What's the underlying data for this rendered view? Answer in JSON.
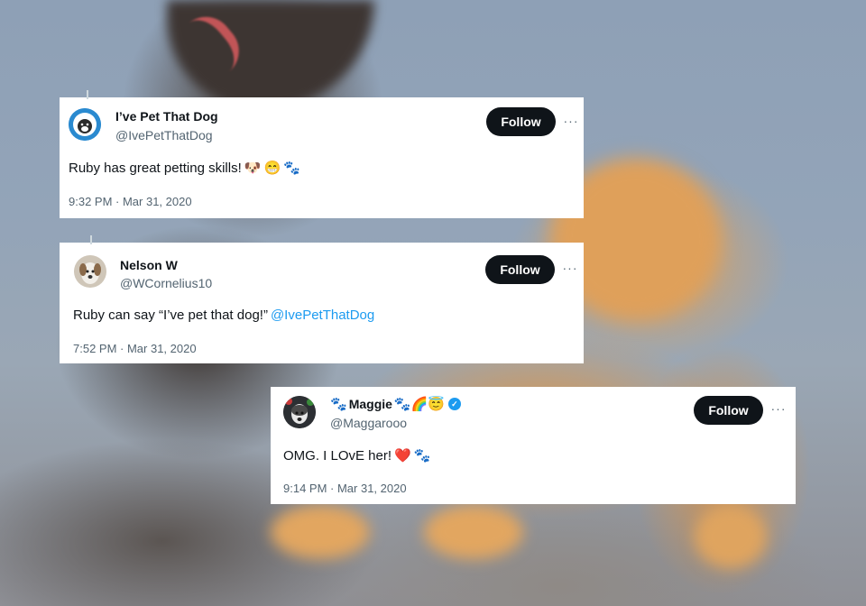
{
  "tweets": [
    {
      "display_name": "I’ve Pet That Dog",
      "handle": "@IvePetThatDog",
      "text": "Ruby has great petting skills!",
      "emojis": [
        "🐶",
        "😁",
        "🐾"
      ],
      "timestamp": "9:32 PM · Mar 31, 2020",
      "follow_label": "Follow",
      "more_label": "···"
    },
    {
      "display_name": "Nelson W",
      "handle": "@WCornelius10",
      "text": "Ruby can say “I’ve pet that dog!”",
      "mention": "@IvePetThatDog",
      "timestamp": "7:52 PM · Mar 31, 2020",
      "follow_label": "Follow",
      "more_label": "···"
    },
    {
      "display_name": "Maggie",
      "name_prefix_emoji": "🐾",
      "name_suffix_emojis": "🐾🌈😇",
      "verified_icon": "verified-badge-icon",
      "handle": "@Maggarooo",
      "text": "OMG. I LOvE her!",
      "emojis": [
        "❤️",
        "🐾"
      ],
      "timestamp": "9:14 PM · Mar 31, 2020",
      "follow_label": "Follow",
      "more_label": "···"
    }
  ],
  "colors": {
    "follow_bg": "#0f1419",
    "mention": "#1d9bf0",
    "secondary_text": "#536471",
    "verified": "#1d9bf0"
  }
}
